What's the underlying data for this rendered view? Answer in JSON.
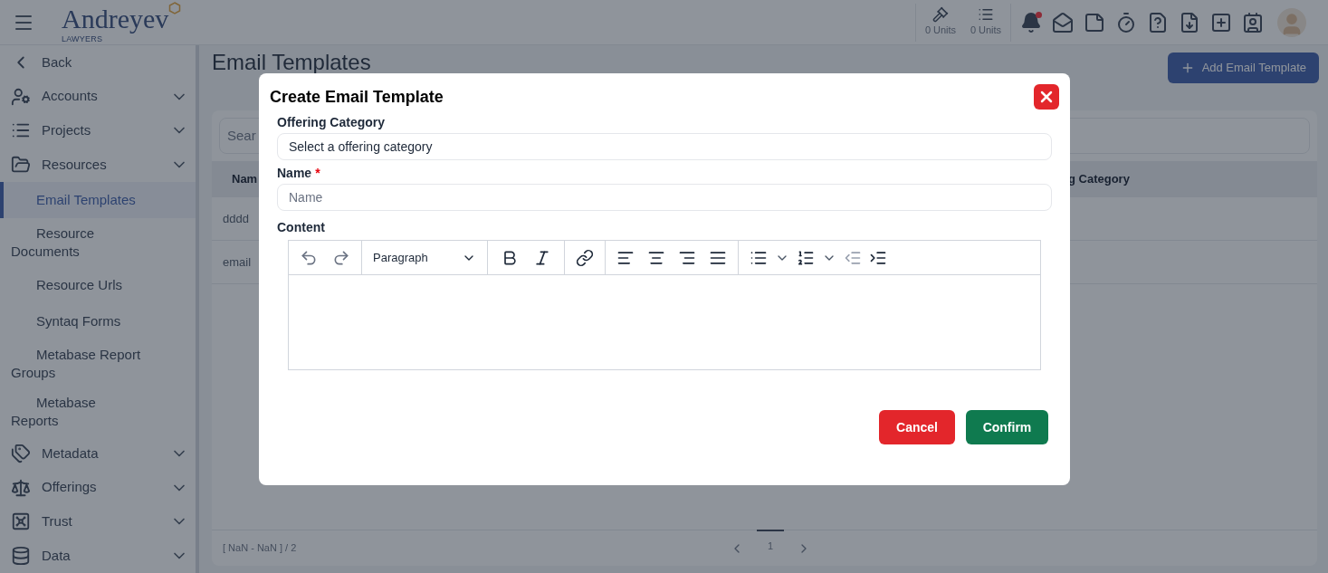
{
  "header": {
    "logo": {
      "name": "Andreyev",
      "tagline": "LAWYERS"
    },
    "unit_counters": [
      {
        "label": "0 Units",
        "kind": "gavel"
      },
      {
        "label": "0 Units",
        "kind": "list"
      }
    ],
    "notifications": {
      "unread": true
    }
  },
  "sidebar": {
    "items": [
      {
        "label": "Back",
        "kind": "back"
      },
      {
        "label": "Accounts",
        "kind": "accounts"
      },
      {
        "label": "Projects",
        "kind": "projects"
      },
      {
        "label": "Resources",
        "kind": "resources",
        "children": [
          {
            "label": "Email Templates",
            "selected": true
          },
          {
            "label": "Resource Documents",
            "selected": false
          },
          {
            "label": "Resource Urls",
            "selected": false
          },
          {
            "label": "Syntaq Forms",
            "selected": false
          },
          {
            "label": "Metabase Report Groups",
            "selected": false
          },
          {
            "label": "Metabase Reports",
            "selected": false
          }
        ]
      },
      {
        "label": "Metadata",
        "kind": "metadata"
      },
      {
        "label": "Offerings",
        "kind": "offerings"
      },
      {
        "label": "Trust",
        "kind": "trust"
      },
      {
        "label": "Data",
        "kind": "data"
      }
    ]
  },
  "page": {
    "title": "Email Templates",
    "add_button": "Add Email Template",
    "search": {
      "placeholder": "Sear"
    },
    "table": {
      "columns": [
        "Nam",
        "g Category"
      ],
      "rows": [
        [
          "dddd"
        ],
        [
          "email"
        ]
      ]
    },
    "footer": {
      "range": "[ NaN - NaN ] / 2",
      "page": "1"
    }
  },
  "dialog": {
    "title": "Create Email Template",
    "fields": [
      {
        "label": "Offering Category",
        "kind": "select",
        "value": "Select a offering category",
        "required": false
      },
      {
        "label": "Name",
        "kind": "text",
        "placeholder": "Name",
        "required": true
      }
    ],
    "required_mark": "*",
    "content": {
      "label": "Content",
      "block_style": "Paragraph"
    },
    "buttons": [
      {
        "label": "Cancel",
        "kind": "danger"
      },
      {
        "label": "Confirm",
        "kind": "primary"
      }
    ]
  }
}
